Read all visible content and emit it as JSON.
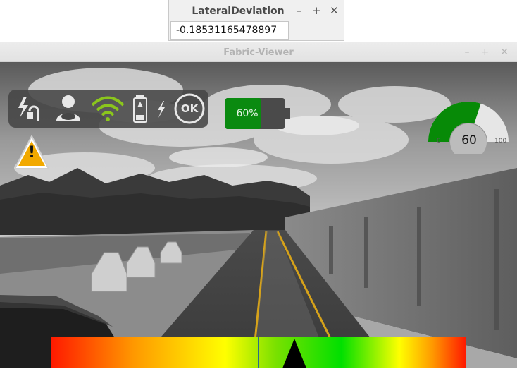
{
  "lateral_window": {
    "title": "LateralDeviation",
    "value": "-0.18531165478897",
    "buttons": {
      "minimize": "–",
      "maximize": "+",
      "close": "✕"
    }
  },
  "viewer_window": {
    "title": "Fabric-Viewer",
    "buttons": {
      "minimize": "–",
      "maximize": "+",
      "close": "✕"
    }
  },
  "status_icons": [
    "power-cable-icon",
    "driver-icon",
    "wifi-icon",
    "battery-icon",
    "charging-bolt-icon",
    "ok-icon"
  ],
  "ok_label": "OK",
  "battery": {
    "label": "60%",
    "level": 0.6,
    "color": "#0a8a10"
  },
  "speed_gauge": {
    "value": "60",
    "min": "0",
    "max": "100",
    "level": 0.6,
    "fill_color": "#078a07",
    "bg_color": "#e6e6e6"
  },
  "warning": {
    "icon": "warning-triangle-icon",
    "color": "#f2a900",
    "symbol": "!"
  },
  "deviation_bar": {
    "pointer_color": "#000000",
    "center_line_color": "#2c6c8a"
  },
  "colors": {
    "lane_yellow": "#d6a21a",
    "panel_bg": "#464646",
    "wifi_green": "#8bc61c"
  }
}
